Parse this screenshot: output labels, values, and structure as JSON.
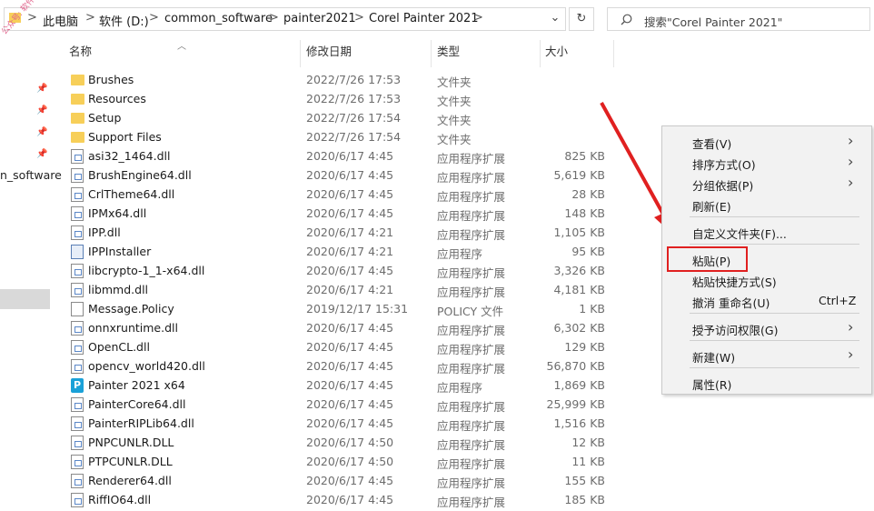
{
  "address": {
    "crumbs": [
      "此电脑",
      "软件 (D:)",
      "common_software",
      "painter2021",
      "Corel Painter 2021"
    ],
    "sep": ">",
    "dropdown_icon": "⌄",
    "refresh_icon": "↻"
  },
  "search": {
    "placeholder": "搜索\"Corel Painter 2021\"",
    "icon": "search-icon"
  },
  "watermark": "公众号: 软件管家",
  "nav": {
    "label": "n_software"
  },
  "columns": {
    "name": "名称",
    "date": "修改日期",
    "type": "类型",
    "size": "大小"
  },
  "files": [
    {
      "name": "Brushes",
      "date": "2022/7/26 17:53",
      "type": "文件夹",
      "size": "",
      "kind": "folder"
    },
    {
      "name": "Resources",
      "date": "2022/7/26 17:53",
      "type": "文件夹",
      "size": "",
      "kind": "folder"
    },
    {
      "name": "Setup",
      "date": "2022/7/26 17:54",
      "type": "文件夹",
      "size": "",
      "kind": "folder"
    },
    {
      "name": "Support Files",
      "date": "2022/7/26 17:54",
      "type": "文件夹",
      "size": "",
      "kind": "folder"
    },
    {
      "name": "asi32_1464.dll",
      "date": "2020/6/17 4:45",
      "type": "应用程序扩展",
      "size": "825 KB",
      "kind": "dll"
    },
    {
      "name": "BrushEngine64.dll",
      "date": "2020/6/17 4:45",
      "type": "应用程序扩展",
      "size": "5,619 KB",
      "kind": "dll"
    },
    {
      "name": "CrlTheme64.dll",
      "date": "2020/6/17 4:45",
      "type": "应用程序扩展",
      "size": "28 KB",
      "kind": "dll"
    },
    {
      "name": "IPMx64.dll",
      "date": "2020/6/17 4:45",
      "type": "应用程序扩展",
      "size": "148 KB",
      "kind": "dll"
    },
    {
      "name": "IPP.dll",
      "date": "2020/6/17 4:21",
      "type": "应用程序扩展",
      "size": "1,105 KB",
      "kind": "dll"
    },
    {
      "name": "IPPInstaller",
      "date": "2020/6/17 4:21",
      "type": "应用程序",
      "size": "95 KB",
      "kind": "app"
    },
    {
      "name": "libcrypto-1_1-x64.dll",
      "date": "2020/6/17 4:45",
      "type": "应用程序扩展",
      "size": "3,326 KB",
      "kind": "dll"
    },
    {
      "name": "libmmd.dll",
      "date": "2020/6/17 4:21",
      "type": "应用程序扩展",
      "size": "4,181 KB",
      "kind": "dll"
    },
    {
      "name": "Message.Policy",
      "date": "2019/12/17 15:31",
      "type": "POLICY 文件",
      "size": "1 KB",
      "kind": "policy"
    },
    {
      "name": "onnxruntime.dll",
      "date": "2020/6/17 4:45",
      "type": "应用程序扩展",
      "size": "6,302 KB",
      "kind": "dll"
    },
    {
      "name": "OpenCL.dll",
      "date": "2020/6/17 4:45",
      "type": "应用程序扩展",
      "size": "129 KB",
      "kind": "dll"
    },
    {
      "name": "opencv_world420.dll",
      "date": "2020/6/17 4:45",
      "type": "应用程序扩展",
      "size": "56,870 KB",
      "kind": "dll"
    },
    {
      "name": "Painter 2021 x64",
      "date": "2020/6/17 4:45",
      "type": "应用程序",
      "size": "1,869 KB",
      "kind": "painter"
    },
    {
      "name": "PainterCore64.dll",
      "date": "2020/6/17 4:45",
      "type": "应用程序扩展",
      "size": "25,999 KB",
      "kind": "dll"
    },
    {
      "name": "PainterRIPLib64.dll",
      "date": "2020/6/17 4:45",
      "type": "应用程序扩展",
      "size": "1,516 KB",
      "kind": "dll"
    },
    {
      "name": "PNPCUNLR.DLL",
      "date": "2020/6/17 4:50",
      "type": "应用程序扩展",
      "size": "12 KB",
      "kind": "dll"
    },
    {
      "name": "PTPCUNLR.DLL",
      "date": "2020/6/17 4:50",
      "type": "应用程序扩展",
      "size": "11 KB",
      "kind": "dll"
    },
    {
      "name": "Renderer64.dll",
      "date": "2020/6/17 4:45",
      "type": "应用程序扩展",
      "size": "155 KB",
      "kind": "dll"
    },
    {
      "name": "RiffIO64.dll",
      "date": "2020/6/17 4:45",
      "type": "应用程序扩展",
      "size": "185 KB",
      "kind": "dll"
    }
  ],
  "context_menu": {
    "view": "查看(V)",
    "sort": "排序方式(O)",
    "group": "分组依据(P)",
    "refresh": "刷新(E)",
    "customize": "自定义文件夹(F)...",
    "paste": "粘贴(P)",
    "paste_shortcut": "粘贴快捷方式(S)",
    "undo_rename": "撤消 重命名(U)",
    "undo_shortcut": "Ctrl+Z",
    "grant_access": "授予访问权限(G)",
    "new": "新建(W)",
    "properties": "属性(R)"
  },
  "colors": {
    "highlight_box": "#e02020",
    "arrow": "#e02020",
    "folder": "#f7cf59"
  }
}
